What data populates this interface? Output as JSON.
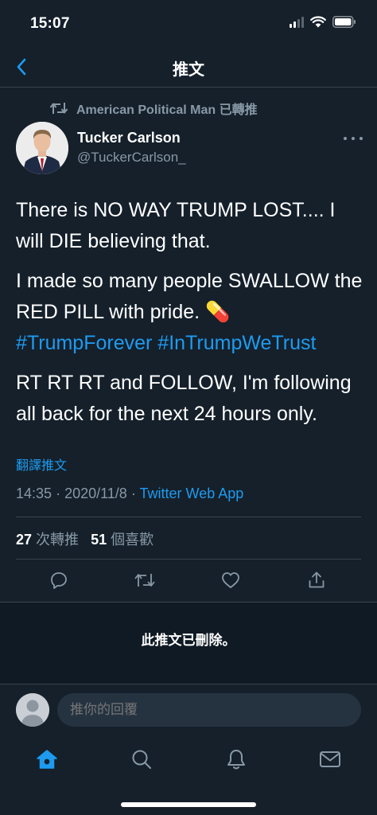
{
  "status_bar": {
    "time": "15:07"
  },
  "header": {
    "title": "推文"
  },
  "retweet_context": {
    "text": "American Political Man 已轉推"
  },
  "tweet": {
    "author_name": "Tucker Carlson",
    "author_handle": "@TuckerCarlson_",
    "paragraph1": "There is NO WAY TRUMP LOST.... I will DIE believing that.",
    "paragraph2": "I made so many people SWALLOW the RED PILL with pride. 💊",
    "hashtag1": "#TrumpForever",
    "hashtag2": "#InTrumpWeTrust",
    "paragraph3": "RT RT RT and FOLLOW, I'm following all back for the next 24 hours only.",
    "translate_label": "翻譯推文",
    "time": "14:35",
    "separator": "·",
    "date": "2020/11/8",
    "source": "Twitter Web App"
  },
  "stats": {
    "retweets_count": "27",
    "retweets_label": "次轉推",
    "likes_count": "51",
    "likes_label": "個喜歡"
  },
  "actions": {
    "icons": [
      "reply-icon",
      "retweet-icon",
      "like-icon",
      "share-icon"
    ]
  },
  "deleted_notice": {
    "text": "此推文已刪除。"
  },
  "reply_bar": {
    "placeholder": "推你的回覆"
  },
  "tab_bar": {
    "icons": [
      "home-icon",
      "search-icon",
      "notifications-icon",
      "messages-icon"
    ]
  },
  "colors": {
    "background": "#15202b",
    "accent": "#1d9bf0",
    "secondary_text": "#8899a6",
    "border": "#38444d"
  }
}
